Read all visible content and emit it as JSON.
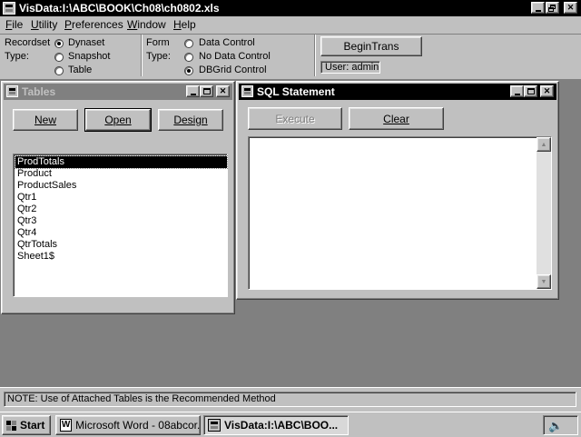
{
  "colors": {
    "titlebar_active": "#000000",
    "titlebar_inactive": "#808080",
    "workspace": "#808080",
    "face": "#c0c0c0",
    "selection": "#000000"
  },
  "app": {
    "title": "VisData:I:\\ABC\\BOOK\\Ch08\\ch0802.xls",
    "icon": "app-icon"
  },
  "menu": [
    {
      "label": "File",
      "hot": "F"
    },
    {
      "label": "Utility",
      "hot": "U"
    },
    {
      "label": "Preferences",
      "hot": "P"
    },
    {
      "label": "Window",
      "hot": "W"
    },
    {
      "label": "Help",
      "hot": "H"
    }
  ],
  "toolbar": {
    "recordset_label": "Recordset",
    "type_label": "Type:",
    "recordset_options": [
      "Dynaset",
      "Snapshot",
      "Table"
    ],
    "recordset_selected": "Dynaset",
    "form_label": "Form",
    "form_type_label": "Type:",
    "form_options": [
      "Data Control",
      "No Data Control",
      "DBGrid Control"
    ],
    "form_selected": "DBGrid Control",
    "begin_trans": "BeginTrans",
    "user": "User: admin"
  },
  "tables_window": {
    "title": "Tables",
    "buttons": [
      "New",
      "Open",
      "Design"
    ],
    "items": [
      "ProdTotals",
      "Product",
      "ProductSales",
      "Qtr1",
      "Qtr2",
      "Qtr3",
      "Qtr4",
      "QtrTotals",
      "Sheet1$"
    ],
    "selected": "ProdTotals"
  },
  "sql_window": {
    "title": "SQL Statement",
    "execute": "Execute",
    "clear": "Clear",
    "text": ""
  },
  "status": {
    "note": "NOTE: Use of Attached Tables is the Recommended Method"
  },
  "taskbar": {
    "start": "Start",
    "tasks": [
      {
        "label": "Microsoft Word - 08abcor....",
        "icon": "word-icon",
        "active": false
      },
      {
        "label": "VisData:I:\\ABC\\BOO...",
        "icon": "app-icon",
        "active": true
      }
    ],
    "tray": [
      "speaker-icon"
    ]
  }
}
